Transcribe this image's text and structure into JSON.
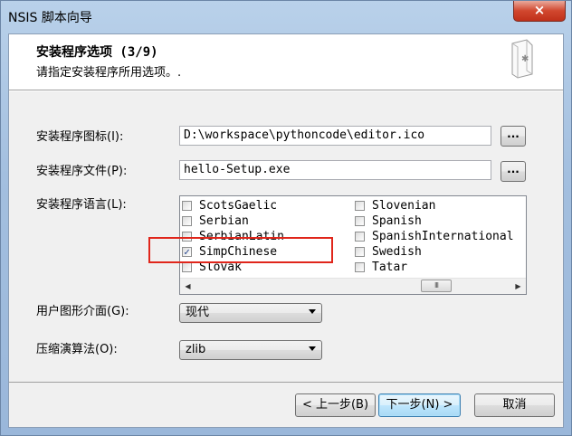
{
  "window": {
    "title": "NSIS 脚本向导",
    "close_glyph": "×"
  },
  "header": {
    "title": "安装程序选项 (3/9)",
    "subtitle": "请指定安装程序所用选项。.",
    "icon": "installer-package-icon"
  },
  "form": {
    "icon_label": "安装程序图标(I):",
    "icon_value": "D:\\workspace\\pythoncode\\editor.ico",
    "file_label": "安装程序文件(P):",
    "file_value": "hello-Setup.exe",
    "browse_label": "...",
    "language_label": "安装程序语言(L):",
    "languages_left": [
      {
        "name": "ScotsGaelic",
        "checked": false
      },
      {
        "name": "Serbian",
        "checked": false
      },
      {
        "name": "SerbianLatin",
        "checked": false
      },
      {
        "name": "SimpChinese",
        "checked": true
      },
      {
        "name": "Slovak",
        "checked": false
      }
    ],
    "languages_right": [
      {
        "name": "Slovenian",
        "checked": false
      },
      {
        "name": "Spanish",
        "checked": false
      },
      {
        "name": "SpanishInternational",
        "checked": false
      },
      {
        "name": "Swedish",
        "checked": false
      },
      {
        "name": "Tatar",
        "checked": false
      }
    ],
    "check_glyph": "✓",
    "scroll_left": "◀",
    "scroll_right": "▶",
    "scroll_thumb": "III",
    "ui_label": "用户图形介面(G):",
    "ui_value": "现代",
    "compress_label": "压缩演算法(O):",
    "compress_value": "zlib"
  },
  "buttons": {
    "back": "< 上一步(B)",
    "next": "下一步(N) >",
    "cancel": "取消"
  },
  "colors": {
    "highlight": "#e0261b",
    "titlebar": "#b9d1ea"
  }
}
